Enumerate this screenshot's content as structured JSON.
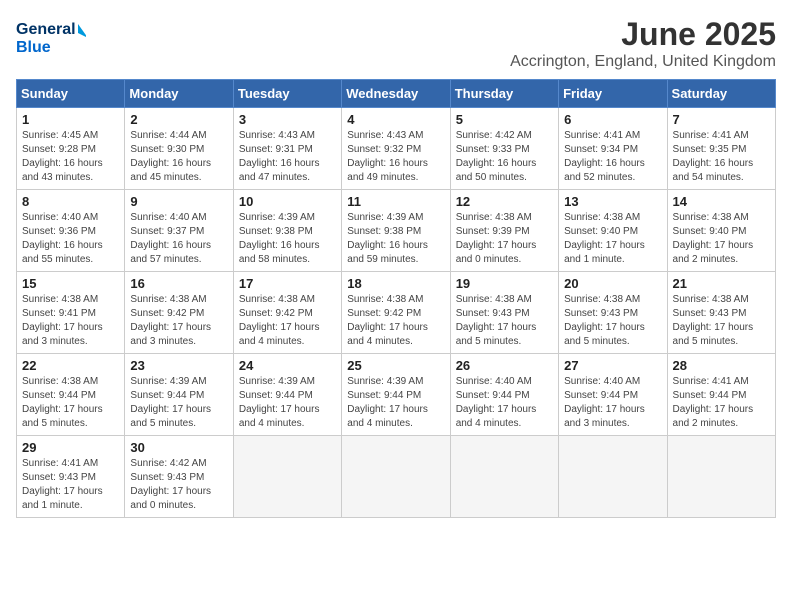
{
  "logo": {
    "line1": "General",
    "line2": "Blue"
  },
  "title": "June 2025",
  "subtitle": "Accrington, England, United Kingdom",
  "days_of_week": [
    "Sunday",
    "Monday",
    "Tuesday",
    "Wednesday",
    "Thursday",
    "Friday",
    "Saturday"
  ],
  "weeks": [
    [
      {
        "day": 1,
        "info": "Sunrise: 4:45 AM\nSunset: 9:28 PM\nDaylight: 16 hours\nand 43 minutes."
      },
      {
        "day": 2,
        "info": "Sunrise: 4:44 AM\nSunset: 9:30 PM\nDaylight: 16 hours\nand 45 minutes."
      },
      {
        "day": 3,
        "info": "Sunrise: 4:43 AM\nSunset: 9:31 PM\nDaylight: 16 hours\nand 47 minutes."
      },
      {
        "day": 4,
        "info": "Sunrise: 4:43 AM\nSunset: 9:32 PM\nDaylight: 16 hours\nand 49 minutes."
      },
      {
        "day": 5,
        "info": "Sunrise: 4:42 AM\nSunset: 9:33 PM\nDaylight: 16 hours\nand 50 minutes."
      },
      {
        "day": 6,
        "info": "Sunrise: 4:41 AM\nSunset: 9:34 PM\nDaylight: 16 hours\nand 52 minutes."
      },
      {
        "day": 7,
        "info": "Sunrise: 4:41 AM\nSunset: 9:35 PM\nDaylight: 16 hours\nand 54 minutes."
      }
    ],
    [
      {
        "day": 8,
        "info": "Sunrise: 4:40 AM\nSunset: 9:36 PM\nDaylight: 16 hours\nand 55 minutes."
      },
      {
        "day": 9,
        "info": "Sunrise: 4:40 AM\nSunset: 9:37 PM\nDaylight: 16 hours\nand 57 minutes."
      },
      {
        "day": 10,
        "info": "Sunrise: 4:39 AM\nSunset: 9:38 PM\nDaylight: 16 hours\nand 58 minutes."
      },
      {
        "day": 11,
        "info": "Sunrise: 4:39 AM\nSunset: 9:38 PM\nDaylight: 16 hours\nand 59 minutes."
      },
      {
        "day": 12,
        "info": "Sunrise: 4:38 AM\nSunset: 9:39 PM\nDaylight: 17 hours\nand 0 minutes."
      },
      {
        "day": 13,
        "info": "Sunrise: 4:38 AM\nSunset: 9:40 PM\nDaylight: 17 hours\nand 1 minute."
      },
      {
        "day": 14,
        "info": "Sunrise: 4:38 AM\nSunset: 9:40 PM\nDaylight: 17 hours\nand 2 minutes."
      }
    ],
    [
      {
        "day": 15,
        "info": "Sunrise: 4:38 AM\nSunset: 9:41 PM\nDaylight: 17 hours\nand 3 minutes."
      },
      {
        "day": 16,
        "info": "Sunrise: 4:38 AM\nSunset: 9:42 PM\nDaylight: 17 hours\nand 3 minutes."
      },
      {
        "day": 17,
        "info": "Sunrise: 4:38 AM\nSunset: 9:42 PM\nDaylight: 17 hours\nand 4 minutes."
      },
      {
        "day": 18,
        "info": "Sunrise: 4:38 AM\nSunset: 9:42 PM\nDaylight: 17 hours\nand 4 minutes."
      },
      {
        "day": 19,
        "info": "Sunrise: 4:38 AM\nSunset: 9:43 PM\nDaylight: 17 hours\nand 5 minutes."
      },
      {
        "day": 20,
        "info": "Sunrise: 4:38 AM\nSunset: 9:43 PM\nDaylight: 17 hours\nand 5 minutes."
      },
      {
        "day": 21,
        "info": "Sunrise: 4:38 AM\nSunset: 9:43 PM\nDaylight: 17 hours\nand 5 minutes."
      }
    ],
    [
      {
        "day": 22,
        "info": "Sunrise: 4:38 AM\nSunset: 9:44 PM\nDaylight: 17 hours\nand 5 minutes."
      },
      {
        "day": 23,
        "info": "Sunrise: 4:39 AM\nSunset: 9:44 PM\nDaylight: 17 hours\nand 5 minutes."
      },
      {
        "day": 24,
        "info": "Sunrise: 4:39 AM\nSunset: 9:44 PM\nDaylight: 17 hours\nand 4 minutes."
      },
      {
        "day": 25,
        "info": "Sunrise: 4:39 AM\nSunset: 9:44 PM\nDaylight: 17 hours\nand 4 minutes."
      },
      {
        "day": 26,
        "info": "Sunrise: 4:40 AM\nSunset: 9:44 PM\nDaylight: 17 hours\nand 4 minutes."
      },
      {
        "day": 27,
        "info": "Sunrise: 4:40 AM\nSunset: 9:44 PM\nDaylight: 17 hours\nand 3 minutes."
      },
      {
        "day": 28,
        "info": "Sunrise: 4:41 AM\nSunset: 9:44 PM\nDaylight: 17 hours\nand 2 minutes."
      }
    ],
    [
      {
        "day": 29,
        "info": "Sunrise: 4:41 AM\nSunset: 9:43 PM\nDaylight: 17 hours\nand 1 minute."
      },
      {
        "day": 30,
        "info": "Sunrise: 4:42 AM\nSunset: 9:43 PM\nDaylight: 17 hours\nand 0 minutes."
      },
      null,
      null,
      null,
      null,
      null
    ]
  ]
}
